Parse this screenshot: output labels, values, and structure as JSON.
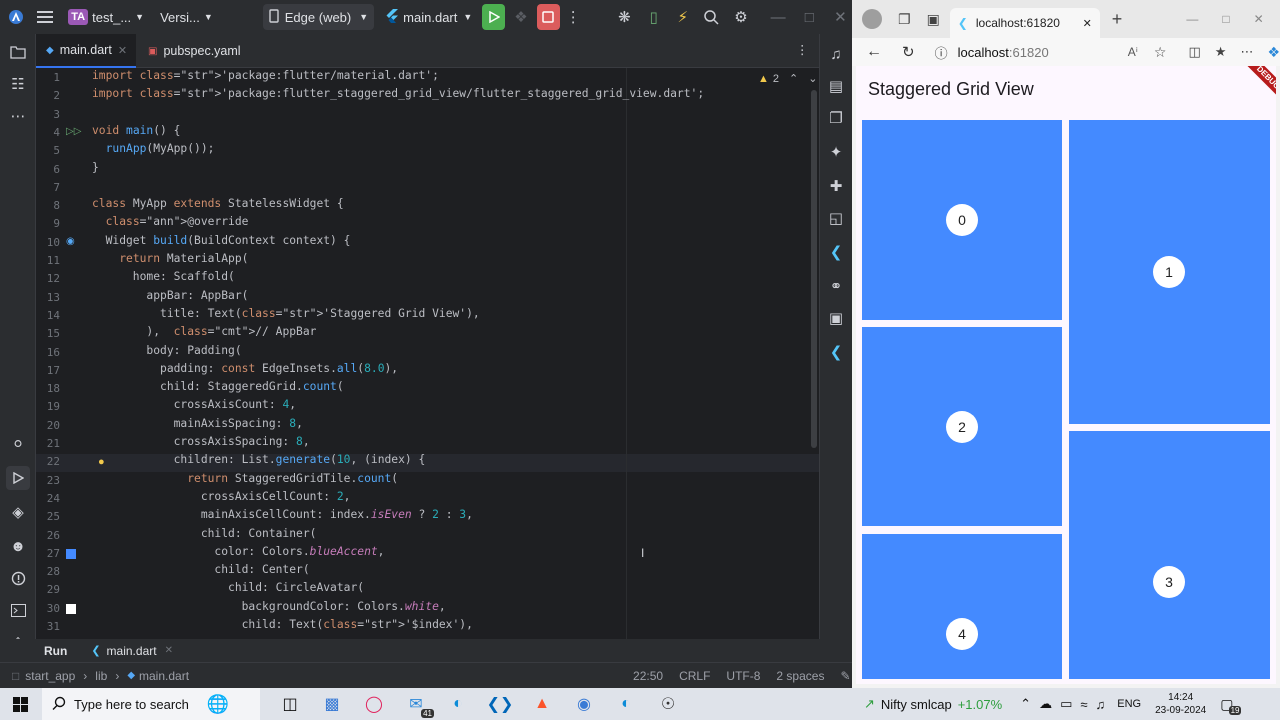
{
  "ide": {
    "title_bar": {
      "project_badge": "TA",
      "project_name": "test_...",
      "vcs_label": "Versi...",
      "device": "Edge (web)",
      "run_config": "main.dart"
    },
    "tabs": [
      {
        "label": "main.dart"
      },
      {
        "label": "pubspec.yaml"
      }
    ],
    "inspection_count": "2",
    "line_numbers": [
      "1",
      "2",
      "3",
      "4",
      "5",
      "6",
      "7",
      "8",
      "9",
      "10",
      "11",
      "12",
      "13",
      "14",
      "15",
      "16",
      "17",
      "18",
      "19",
      "20",
      "21",
      "22",
      "23",
      "24",
      "25",
      "26",
      "27",
      "28",
      "29",
      "30",
      "31"
    ],
    "code_lines": [
      "import 'package:flutter/material.dart';",
      "import 'package:flutter_staggered_grid_view/flutter_staggered_grid_view.dart';",
      "",
      "void main() {",
      "  runApp(MyApp());",
      "}",
      "",
      "class MyApp extends StatelessWidget {",
      "  @override",
      "  Widget build(BuildContext context) {",
      "    return MaterialApp(",
      "      home: Scaffold(",
      "        appBar: AppBar(",
      "          title: Text('Staggered Grid View'),",
      "        ),  // AppBar",
      "        body: Padding(",
      "          padding: const EdgeInsets.all(8.0),",
      "          child: StaggeredGrid.count(",
      "            crossAxisCount: 4,",
      "            mainAxisSpacing: 8,",
      "            crossAxisSpacing: 8,",
      "            children: List.generate(10, (index) {",
      "              return StaggeredGridTile.count(",
      "                crossAxisCellCount: 2,",
      "                mainAxisCellCount: index.isEven ? 2 : 3,",
      "                child: Container(",
      "                  color: Colors.blueAccent,",
      "                  child: Center(",
      "                    child: CircleAvatar(",
      "                      backgroundColor: Colors.white,",
      "                      child: Text('$index'),"
    ],
    "run_panel": {
      "label": "Run",
      "config": "main.dart"
    },
    "breadcrumb": [
      "start_app",
      "lib",
      "main.dart"
    ],
    "status": {
      "position": "22:50",
      "line_sep": "CRLF",
      "encoding": "UTF-8",
      "indent": "2 spaces"
    }
  },
  "browser": {
    "tab_title": "localhost:61820",
    "address": "localhost:61820",
    "address_host": "localhost",
    "address_port": ":61820",
    "debug_banner": "DEBUG",
    "app": {
      "title": "Staggered Grid View",
      "accent": "#448aff",
      "tiles": [
        "0",
        "1",
        "2",
        "3",
        "4"
      ]
    }
  },
  "taskbar": {
    "search_placeholder": "Type here to search",
    "mail_badge": "41",
    "stock_name": "Nifty smlcap",
    "stock_change": "+1.07%",
    "language": "ENG",
    "time": "14:24",
    "date": "23-09-2024",
    "notif_count": "19"
  }
}
